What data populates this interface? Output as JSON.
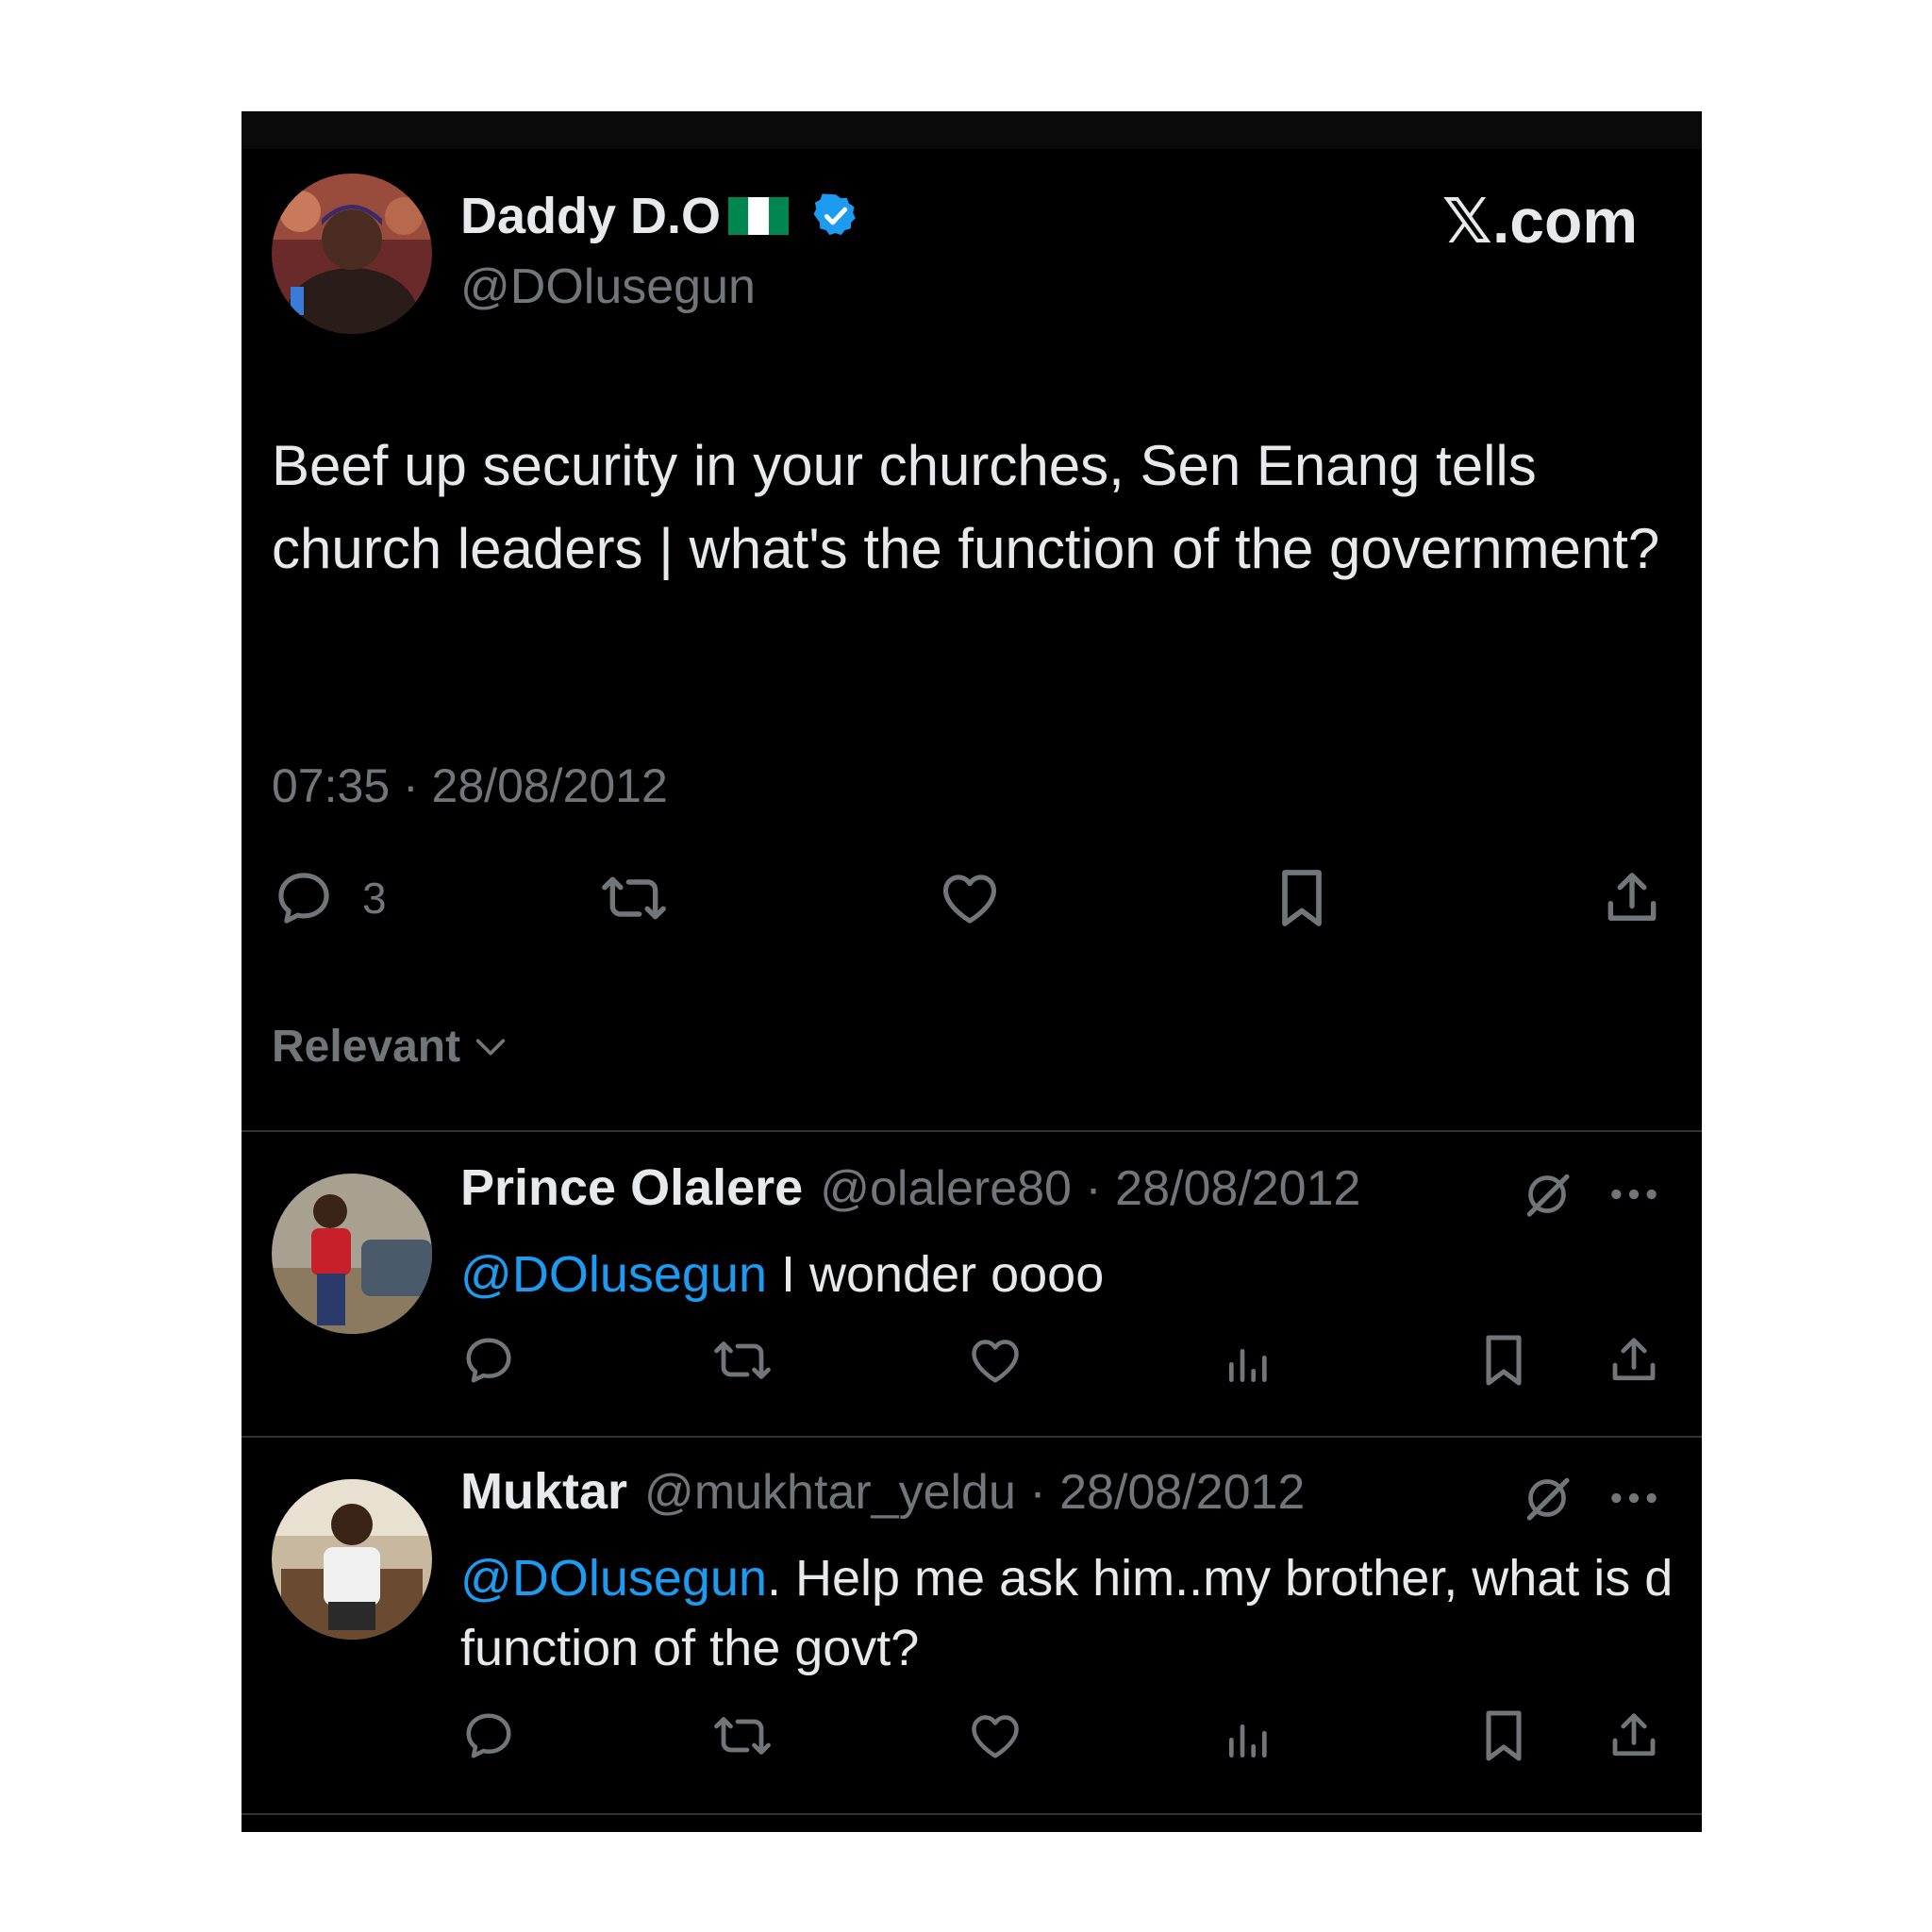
{
  "post": {
    "display_name": "Daddy D.O",
    "flag_icon": "nigeria-flag-icon",
    "verified_icon": "verified-badge-icon",
    "handle": "@DOlusegun",
    "brand": "𝕏.com",
    "text": "Beef up security in your churches, Sen Enang tells church leaders | what's the function of the government?",
    "time": "07:35",
    "date": "28/08/2012",
    "timestamp": "07:35 · 28/08/2012",
    "reply_count": "3"
  },
  "sort": {
    "label": "Relevant"
  },
  "replies": [
    {
      "name": "Prince Olalere",
      "handle": "@olalere80",
      "date": "28/08/2012",
      "meta": "@olalere80 · 28/08/2012",
      "mention": "@DOlusegun",
      "text": " I wonder oooo"
    },
    {
      "name": "Muktar",
      "handle": "@mukhtar_yeldu",
      "date": "28/08/2012",
      "meta": "@mukhtar_yeldu · 28/08/2012",
      "mention": "@DOlusegun",
      "text": ". Help me ask him..my brother, what is d function of the govt?"
    }
  ],
  "colors": {
    "background": "#000000",
    "text": "#e7e9ea",
    "muted": "#71767b",
    "accent": "#1d9bf0",
    "divider": "#2f3336"
  }
}
